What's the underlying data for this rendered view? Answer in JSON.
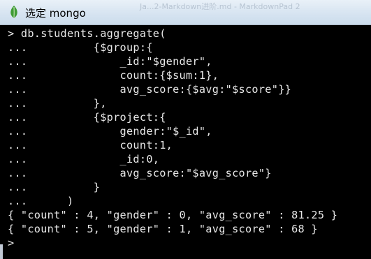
{
  "window": {
    "title": "选定 mongo",
    "icon": "mongodb-leaf-icon",
    "background_ghost_title": "Ja...2-Markdown进阶.md - MarkdownPad 2"
  },
  "colors": {
    "console_bg": "#000000",
    "console_text": "#e8e8e8",
    "titlebar": "#d7e4f1",
    "icon_green": "#3f9b35"
  },
  "console": {
    "lines": [
      "> db.students.aggregate(",
      "...          {$group:{",
      "...              _id:\"$gender\",",
      "...              count:{$sum:1},",
      "...              avg_score:{$avg:\"$score\"}}",
      "...          },",
      "...          {$project:{",
      "...              gender:\"$_id\",",
      "...              count:1,",
      "...              _id:0,",
      "...              avg_score:\"$avg_score\"}",
      "...          }",
      "...      )",
      "{ \"count\" : 4, \"gender\" : 0, \"avg_score\" : 81.25 }",
      "{ \"count\" : 5, \"gender\" : 1, \"avg_score\" : 68 }"
    ],
    "prompt": ">"
  }
}
